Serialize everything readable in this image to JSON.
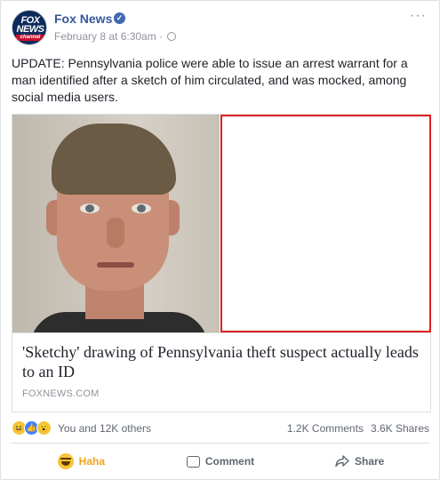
{
  "post": {
    "page_name": "Fox News",
    "timestamp": "February 8 at 6:30am",
    "separator": " · ",
    "text": "UPDATE: Pennsylvania police were able to issue an arrest warrant for a man identified after a sketch of him circulated, and was mocked, among social media users.",
    "avatar_logo_text": "FOX NEWS",
    "avatar_logo_sub": "channel",
    "more_menu": "···"
  },
  "link": {
    "title": "'Sketchy' drawing of Pennsylvania theft suspect actually leads to an ID",
    "domain": "FOXNEWS.COM"
  },
  "stats": {
    "reactions_text": "You and 12K others",
    "comments": "1.2K Comments",
    "shares": "3.6K Shares"
  },
  "actions": {
    "haha": "Haha",
    "comment": "Comment",
    "share": "Share"
  },
  "colors": {
    "link_blue": "#365899",
    "haha_orange": "#f0a21a",
    "redaction_border": "#e02020"
  }
}
